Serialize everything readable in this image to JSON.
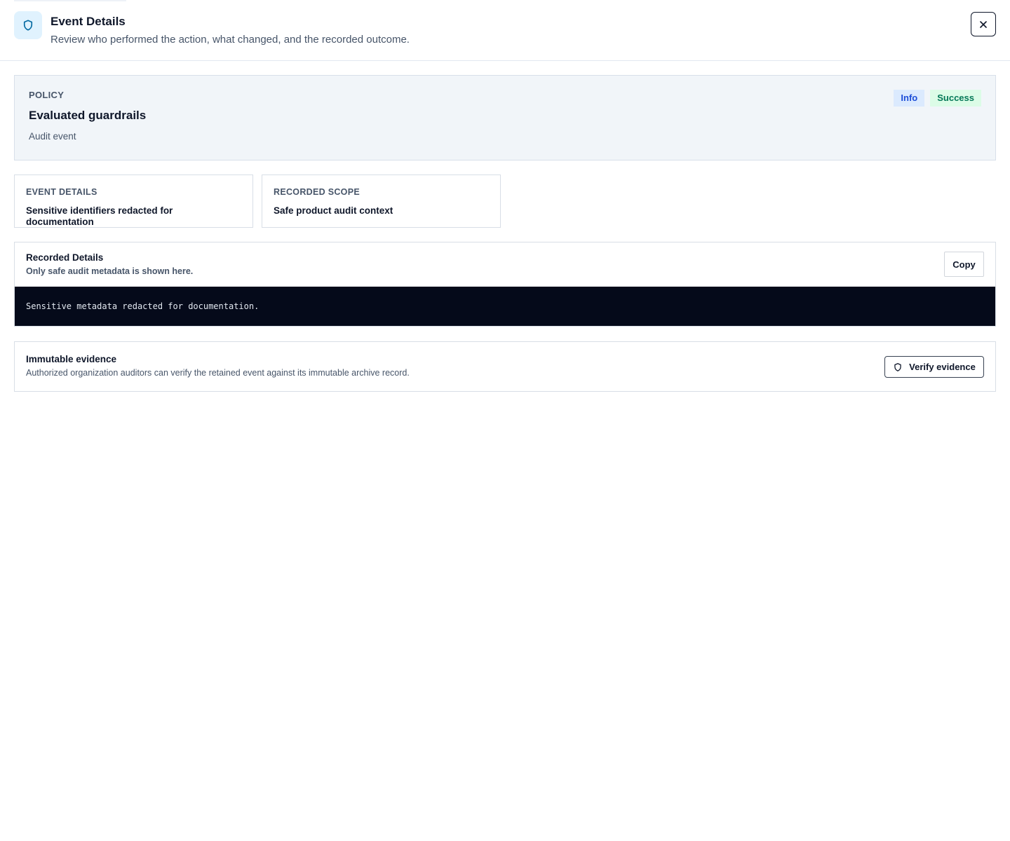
{
  "header": {
    "title": "Event Details",
    "subtitle": "Review who performed the action, what changed, and the recorded outcome.",
    "icon": "shield-icon",
    "close_icon": "close-icon"
  },
  "summary": {
    "category": "POLICY",
    "title": "Evaluated guardrails",
    "subtitle": "Audit event",
    "badges": {
      "severity": "Info",
      "outcome": "Success"
    }
  },
  "cards": [
    {
      "label": "EVENT DETAILS",
      "value": "Sensitive identifiers redacted for documentation"
    },
    {
      "label": "RECORDED SCOPE",
      "value": "Safe product audit context"
    }
  ],
  "recorded": {
    "title": "Recorded Details",
    "subtitle": "Only safe audit metadata is shown here.",
    "copy_label": "Copy",
    "code": "Sensitive metadata redacted for documentation."
  },
  "evidence": {
    "title": "Immutable evidence",
    "description": "Authorized organization auditors can verify the retained event against its immutable archive record.",
    "verify_label": "Verify evidence",
    "verify_icon": "shield-icon"
  },
  "colors": {
    "accent": "#0369a1",
    "info_badge_bg": "#dbeafe",
    "info_badge_text": "#1d4ed8",
    "success_badge_bg": "#dcfce7",
    "success_badge_text": "#047857",
    "code_bg": "#050a1a"
  }
}
